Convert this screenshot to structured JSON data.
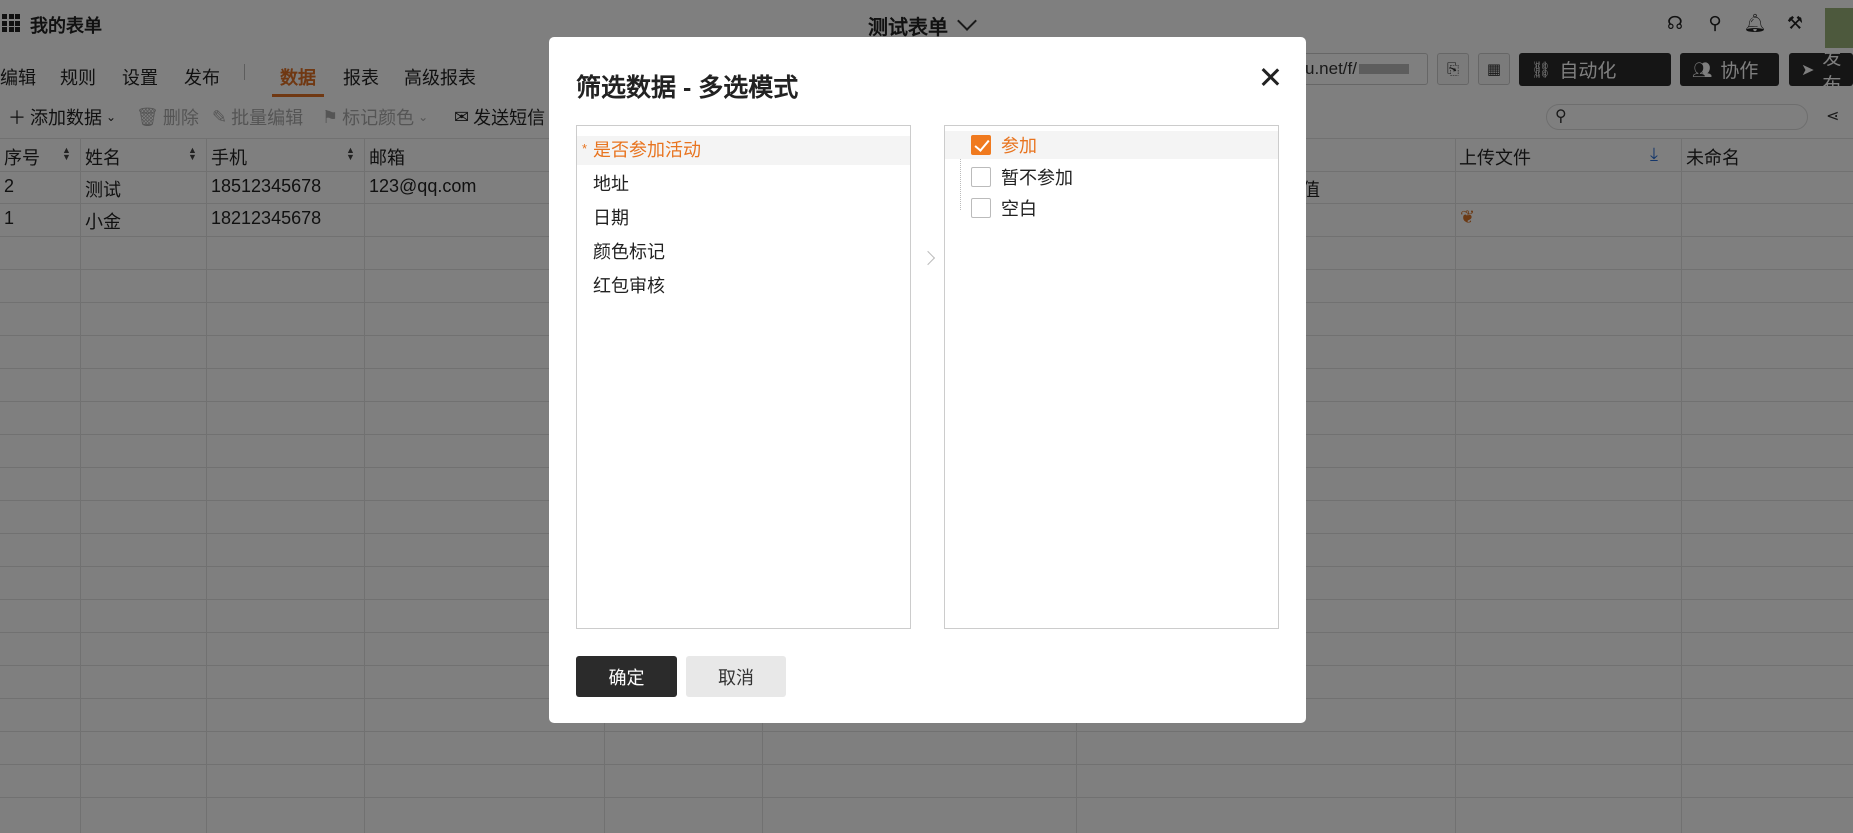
{
  "app": {
    "title": "我的表单",
    "form_title": "测试表单"
  },
  "nav": {
    "tabs": [
      "编辑",
      "规则",
      "设置",
      "发布",
      "数据",
      "报表",
      "高级报表"
    ],
    "active_tab": "数据"
  },
  "header_actions": {
    "url_text": "u.net/f/",
    "automation_label": "自动化",
    "collaborate_label": "协作",
    "publish_label": "发布"
  },
  "toolbar": {
    "add_data": "添加数据",
    "delete": "删除",
    "batch_edit": "批量编辑",
    "mark_color": "标记颜色",
    "send_sms": "发送短信"
  },
  "table": {
    "headers": [
      "序号",
      "姓名",
      "手机",
      "邮箱",
      "上传文件",
      "未命名"
    ],
    "rows": [
      {
        "id": "2",
        "name": "测试",
        "phone": "18512345678",
        "email": "123@qq.com",
        "partial": "值"
      },
      {
        "id": "1",
        "name": "小金",
        "phone": "18212345678",
        "email": "",
        "partial": ""
      }
    ]
  },
  "modal": {
    "title": "筛选数据 - 多选模式",
    "fields": [
      {
        "label": "是否参加活动",
        "selected": true
      },
      {
        "label": "地址",
        "selected": false
      },
      {
        "label": "日期",
        "selected": false
      },
      {
        "label": "颜色标记",
        "selected": false
      },
      {
        "label": "红包审核",
        "selected": false
      }
    ],
    "options": [
      {
        "label": "参加",
        "checked": true
      },
      {
        "label": "暂不参加",
        "checked": false
      },
      {
        "label": "空白",
        "checked": false
      }
    ],
    "confirm_label": "确定",
    "cancel_label": "取消"
  },
  "colors": {
    "accent": "#e8741f",
    "dark_button": "#2b2b2b"
  }
}
